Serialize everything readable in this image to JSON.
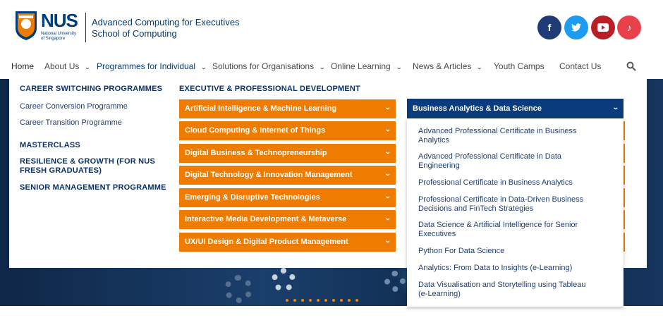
{
  "brand": {
    "nus": "NUS",
    "nus_sub_1": "National University",
    "nus_sub_2": "of Singapore",
    "line1": "Advanced Computing for Executives",
    "line2": "School of Computing",
    "colors": {
      "primary": "#003d7c",
      "accent": "#ef7c00"
    }
  },
  "social": [
    {
      "name": "facebook-icon",
      "glyph": "f",
      "color": "#1e3b78"
    },
    {
      "name": "twitter-icon",
      "glyph": "🐦",
      "color": "#1c9bef"
    },
    {
      "name": "youtube-icon",
      "glyph": "▶",
      "color": "#b91f24"
    },
    {
      "name": "tiktok-icon",
      "glyph": "♪",
      "color": "#e8414c"
    }
  ],
  "nav": {
    "home": "Home",
    "about": "About Us",
    "programmes": "Programmes for Individual",
    "solutions": "Solutions for Organisations",
    "online": "Online Learning",
    "news": "News & Articles",
    "youth": "Youth Camps",
    "contact": "Contact Us"
  },
  "menu": {
    "career_head": "CAREER SWITCHING PROGRAMMES",
    "career_conversion": "Career Conversion Programme",
    "career_transition": "Career Transition Programme",
    "masterclass": "MASTERCLASS",
    "resilience_1": "RESILIENCE & GROWTH (FOR NUS",
    "resilience_2": "FRESH GRADUATES)",
    "senior": "SENIOR MANAGEMENT PROGRAMME",
    "exec_head": "EXECUTIVE & PROFESSIONAL DEVELOPMENT",
    "categories": [
      "Artificial Intelligence & Machine Learning",
      "Cloud Computing & Internet of Things",
      "Digital Business & Technopreneurship",
      "Digital Technology & Innovation Management",
      "Emerging & Disruptive Technologies",
      "Interactive Media Development & Metaverse",
      "UX/UI Design & Digital Product Management"
    ],
    "selected_category": "Business Analytics & Data Science",
    "courses": [
      [
        "Advanced Professional Certificate in Business",
        "Analytics"
      ],
      [
        "Advanced Professional Certificate in Data",
        "Engineering"
      ],
      [
        "Professional Certificate in Business Analytics",
        ""
      ],
      [
        "Professional Certificate in Data-Driven Business",
        "Decisions and FinTech Strategies"
      ],
      [
        "Data Science & Artificial Intelligence for Senior",
        "Executives"
      ],
      [
        "Python For Data Science",
        ""
      ],
      [
        "Analytics: From Data to Insights (e-Learning)",
        ""
      ],
      [
        "Data Visualisation and Storytelling using Tableau",
        "(e-Learning)"
      ]
    ]
  }
}
